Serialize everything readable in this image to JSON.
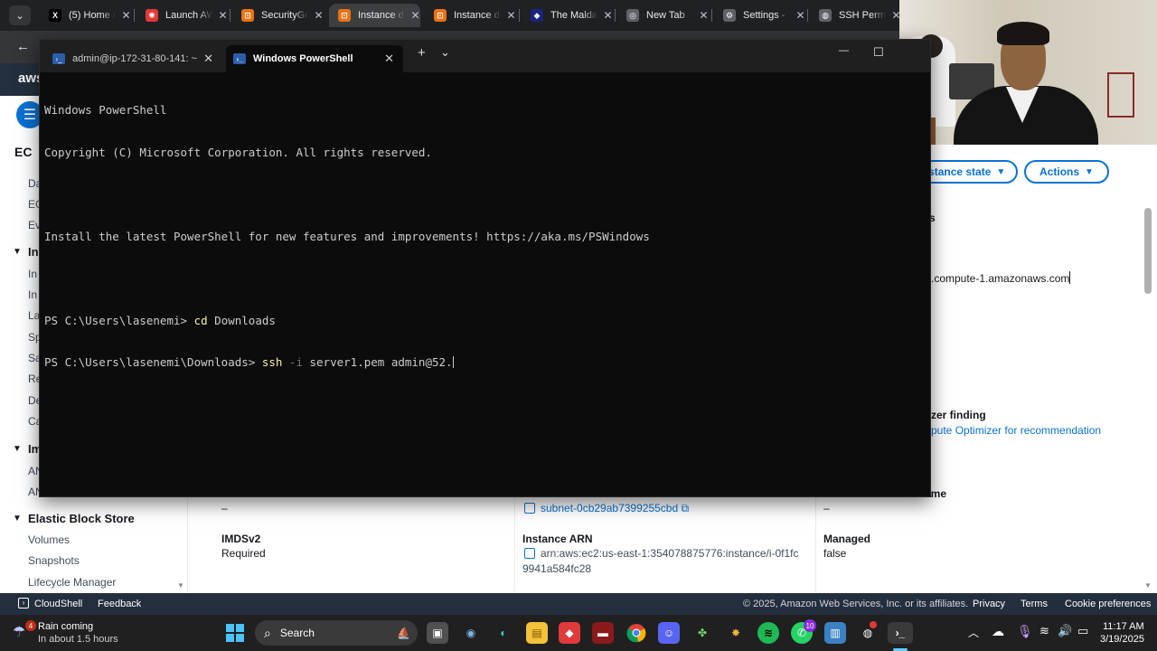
{
  "browser": {
    "tabs": [
      {
        "title": "(5) Home /",
        "favicon": "x-logo-icon",
        "fav_char": "X",
        "fav_bg": "#000000"
      },
      {
        "title": "Launch AW",
        "favicon": "aws-launch-icon",
        "fav_char": "✺",
        "fav_bg": "#e53935"
      },
      {
        "title": "SecurityGr",
        "favicon": "aws-ec2-icon",
        "fav_char": "⊡",
        "fav_bg": "#ec7211"
      },
      {
        "title": "Instance d",
        "favicon": "aws-ec2-icon",
        "fav_char": "⊡",
        "fav_bg": "#ec7211"
      },
      {
        "title": "Instance d",
        "favicon": "aws-ec2-icon",
        "fav_char": "⊡",
        "fav_bg": "#ec7211"
      },
      {
        "title": "The Malda",
        "favicon": "site-icon",
        "fav_char": "◆",
        "fav_bg": "#1a237e"
      },
      {
        "title": "New Tab",
        "favicon": "chrome-icon",
        "fav_char": "◎",
        "fav_bg": "#5f6368"
      },
      {
        "title": "Settings -",
        "favicon": "gear-icon",
        "fav_char": "⚙",
        "fav_bg": "#5f6368"
      },
      {
        "title": "SSH Perm",
        "favicon": "globe-icon",
        "fav_char": "◍",
        "fav_bg": "#5f6368"
      }
    ],
    "close_glyph": "✕",
    "menu_glyph": "⌄"
  },
  "aws": {
    "logo_text": "aws",
    "sidebar_peek": [
      "Da",
      "EC",
      "Ev",
      "In",
      "In",
      "La",
      "Sp",
      "Sa",
      "Re",
      "De",
      "Ca",
      "AN",
      "AN"
    ],
    "sidebar_partial_heading_1": "EC",
    "sidebar_section_instances": "In",
    "sidebar_section_images": "Im",
    "ebs": {
      "heading": "Elastic Block Store",
      "items": [
        "Volumes",
        "Snapshots",
        "Lifecycle Manager"
      ]
    },
    "instance_state_button": "nstance state",
    "actions_button": "Actions",
    "peek_s": "s",
    "dns_partial": ".compute-1.amazonaws.com",
    "optimizer_heading": "zer finding",
    "optimizer_link": "pute Optimizer for recommendation",
    "dash": "–",
    "subnet_link": "subnet-0cb29ab7399255cbd",
    "name_partial": "ame",
    "imds_label": "IMDSv2",
    "imds_value": "Required",
    "arn_label": "Instance ARN",
    "arn_value_1": "arn:aws:ec2:us-east-1:354078875776:instance/i-0f1fc",
    "arn_value_2": "9941a584fc28",
    "managed_label": "Managed",
    "managed_value": "false",
    "footer": {
      "cloudshell": "CloudShell",
      "feedback": "Feedback",
      "copyright": "© 2025, Amazon Web Services, Inc. or its affiliates.",
      "privacy": "Privacy",
      "terms": "Terms",
      "cookie": "Cookie preferences"
    }
  },
  "terminal": {
    "tab1_title": "admin@ip-172-31-80-141: ~",
    "tab2_title": "Windows PowerShell",
    "new_tab_glyph": "+",
    "dropdown_glyph": "⌄",
    "minimize_glyph": "—",
    "maximize_glyph": "☐",
    "line1": "Windows PowerShell",
    "line2": "Copyright (C) Microsoft Corporation. All rights reserved.",
    "line3": "Install the latest PowerShell for new features and improvements! https://aka.ms/PSWindows",
    "prompt1": "PS C:\\Users\\lasenemi> ",
    "cmd1": "cd",
    "arg1": " Downloads",
    "prompt2": "PS C:\\Users\\lasenemi\\Downloads> ",
    "cmd2": "ssh",
    "flag2": " -i",
    "arg2": " server1.pem admin@52."
  },
  "taskbar": {
    "weather_title": "Rain coming",
    "weather_sub": "In about 1.5 hours",
    "weather_badge": "4",
    "search_label": "Search",
    "whatsapp_badge": "10",
    "time": "11:17 AM",
    "date": "3/19/2025"
  }
}
